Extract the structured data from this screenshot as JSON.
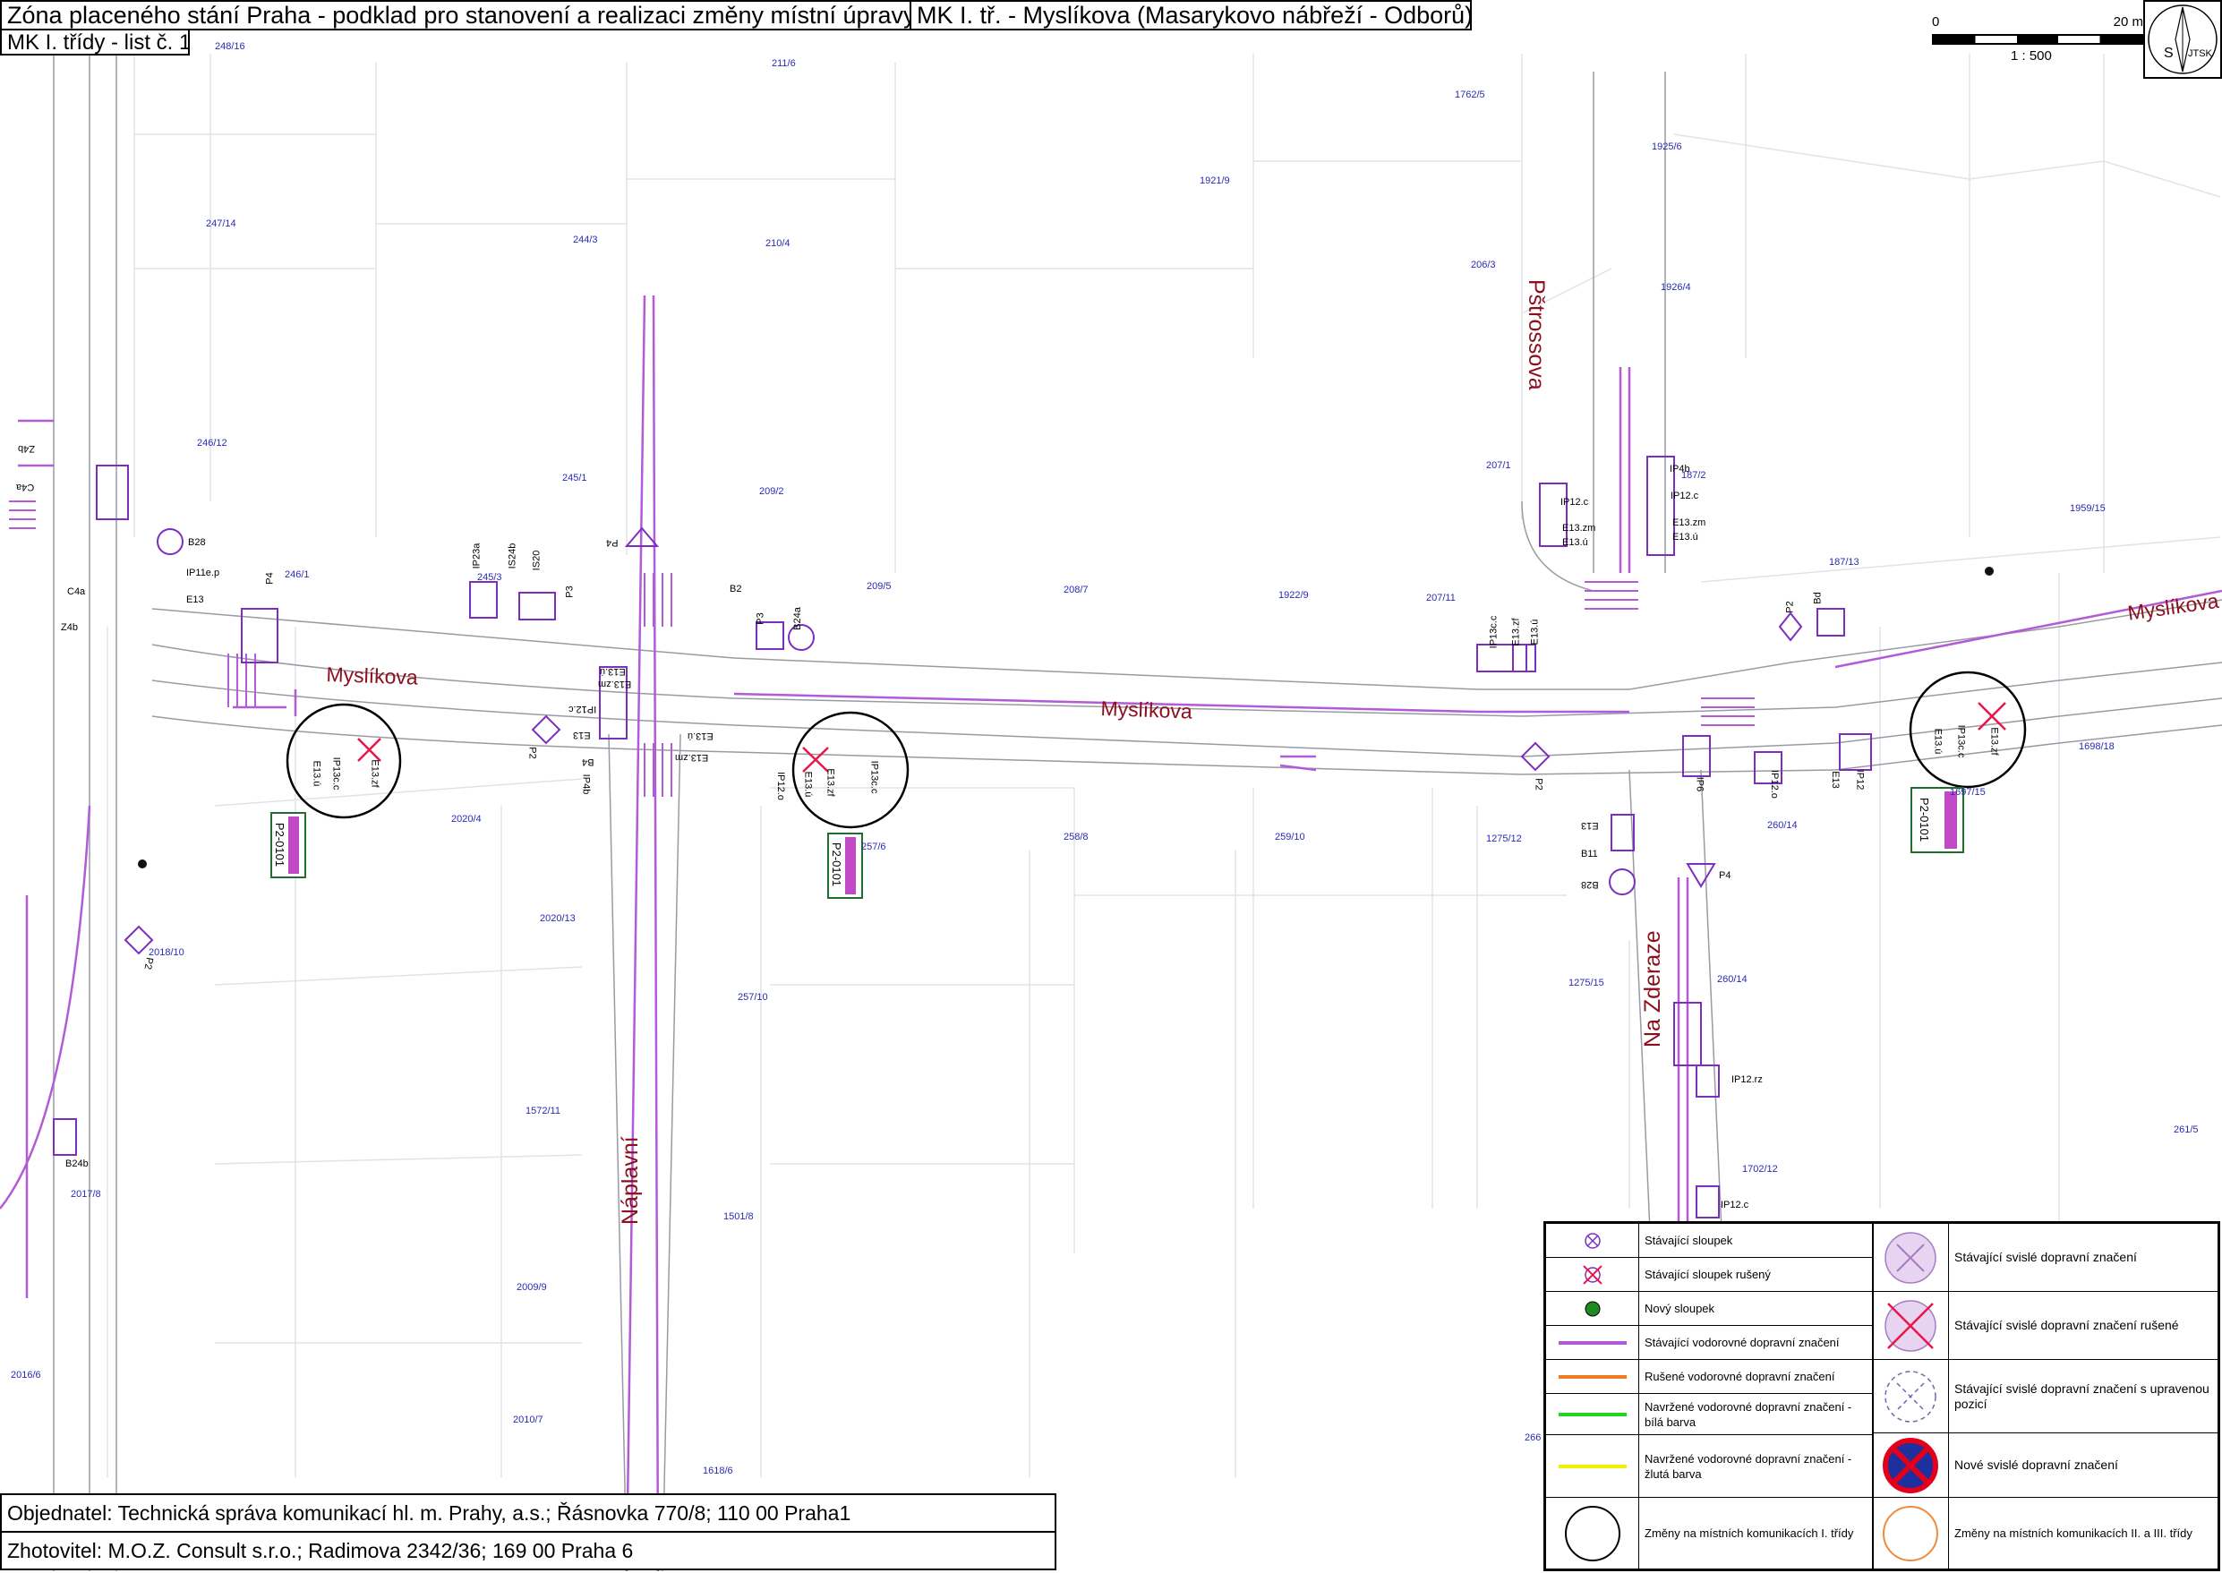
{
  "header": {
    "title": "Zóna placeného stání Praha - podklad pro stanovení a realizaci změny místní úpravy",
    "route": "MK I. tř. - Myslíkova (Masarykovo nábřeží - Odborů)",
    "sheet": "MK I. třídy - list č. 1"
  },
  "scale_bar": {
    "start": "0",
    "end": "20 m",
    "ratio": "1 : 500"
  },
  "north_arrow": {
    "letter": "S",
    "system": "JTSK"
  },
  "streets": {
    "myslikova_west": "Myslíkova",
    "myslikova_center": "Myslíkova",
    "myslikova_east": "Myslíkova",
    "pstrossova": "Pštrossova",
    "na_zderaze": "Na Zderaze",
    "naplavni": "Náplavní"
  },
  "parcels": [
    "248/16",
    "211/6",
    "1762/5",
    "1925/6",
    "1921/9",
    "247/14",
    "244/3",
    "210/4",
    "206/3",
    "1926/4",
    "246/12",
    "245/1",
    "209/2",
    "207/1",
    "187/2",
    "1959/15",
    "246/1",
    "245/3",
    "209/5",
    "208/7",
    "1922/9",
    "207/11",
    "187/13",
    "2020/4",
    "257/6",
    "258/8",
    "259/10",
    "1275/12",
    "260/14",
    "1697/15",
    "1698/18",
    "2020/13",
    "2018/10",
    "257/10",
    "1275/15",
    "260/14",
    "1572/11",
    "1702/12",
    "2017/8",
    "1501/8",
    "2009/9",
    "2016/6",
    "2010/7",
    "1618/6",
    "261/5",
    "266"
  ],
  "signs": [
    "Z4b",
    "C4a",
    "C4a",
    "Z4b",
    "B28",
    "IP11e.p",
    "E13",
    "P4",
    "IP23a",
    "IS24b",
    "IS20",
    "P3",
    "P4",
    "B2",
    "P3",
    "B24a",
    "IP12.c",
    "IP4b",
    "IP12.c",
    "E13.zm",
    "E13.ú",
    "E13.zm",
    "E13.ú",
    "IP13c.c",
    "E13.zf",
    "E13.ú",
    "P2",
    "Bd",
    "E13.ú",
    "E13.zm",
    "IP12.c",
    "E13",
    "P2",
    "B4",
    "IP4b",
    "E13.ú",
    "E13.zm",
    "IP12.o",
    "E13.zf",
    "E13.ú",
    "IP13c.c",
    "E13.ú",
    "E13.zf",
    "IP13c.c",
    "E13.ú",
    "E13.zf",
    "IP13c.c",
    "P2",
    "E13",
    "B11",
    "B28",
    "IP6",
    "P4",
    "IP12.o",
    "E13",
    "IP12",
    "IP12.rz",
    "IP12.c",
    "B24b",
    "P2"
  ],
  "plates": [
    "P2-0101",
    "P2-0101",
    "P2-0101"
  ],
  "legend": {
    "left": [
      "Stávající sloupek",
      "Stávající sloupek rušený",
      "Nový sloupek",
      "Stávající vodorovné dopravní značení",
      "Rušené vodorovné dopravní značení",
      "Navržené vodorovné dopravní značení - bílá barva",
      "Navržené vodorovné dopravní značení - žlutá barva",
      "Změny na místních komunikacích I. třídy"
    ],
    "right": [
      "Stávající svislé dopravní značení",
      "Stávající svislé dopravní značení rušené",
      "Stávající svislé dopravní značení s upravenou pozicí",
      "Nové svislé dopravní značení",
      "Změny na místních komunikacích II. a III. třídy"
    ]
  },
  "footer": {
    "client": "Objednatel: Technická správa komunikací hl. m. Prahy, a.s.; Řásnovka 770/8; 110 00 Praha1",
    "contractor": "Zhotovitel: M.O.Z. Consult s.r.o.; Radimova 2342/36; 169 00 Praha 6"
  },
  "colors": {
    "marking": "#b35ad6",
    "sign": "#7b2fbe",
    "parcel_text": "#2a2ab4",
    "street_text": "#8b0f1c",
    "removed": "#e8164a",
    "new_post": "#1f8a1f",
    "removed_marking": "#f07a22",
    "proposed_white": "#22d622",
    "proposed_yellow": "#f2f200",
    "change_local2": "#f08a3c",
    "new_sign_red": "#e3001b",
    "new_sign_blue": "#1e2f9e",
    "building": "#e6e6ee"
  }
}
